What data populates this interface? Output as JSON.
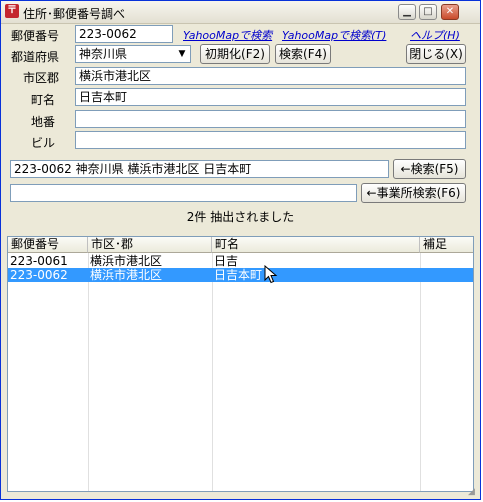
{
  "window": {
    "title": "住所･郵便番号調べ",
    "minimize": "▁",
    "maximize": "□",
    "close": "✕"
  },
  "form": {
    "postal_label": "郵便番号",
    "postal_value": "223-0062",
    "pref_label": "都道府県",
    "pref_value": "神奈川県",
    "city_label": "市区郡",
    "city_value": "横浜市港北区",
    "town_label": "町名",
    "town_value": "日吉本町",
    "banchi_label": "地番",
    "banchi_value": "",
    "building_label": "ビル",
    "building_value": ""
  },
  "links": {
    "yahoo_map": "YahooMapで検索",
    "yahoo_map_t": "YahooMapで検索(T)",
    "help": "ヘルプ(H)"
  },
  "buttons": {
    "init": "初期化(F2)",
    "search": "検索(F4)",
    "close": "閉じる(X)",
    "back_search": "←検索(F5)",
    "office_search": "←事業所検索(F6)"
  },
  "result": {
    "address_value": "223-0062 神奈川県 横浜市港北区 日吉本町",
    "office_value": "",
    "count_text": "2件 抽出されました"
  },
  "table": {
    "headers": [
      "郵便番号",
      "市区･郡",
      "町名",
      "補足"
    ],
    "rows": [
      [
        "223-0061",
        "横浜市港北区",
        "日吉",
        ""
      ],
      [
        "223-0062",
        "横浜市港北区",
        "日吉本町",
        ""
      ]
    ],
    "selected_row": 1
  },
  "colors": {
    "selection": "#3399ff",
    "link": "#0000cc",
    "face": "#ece9d8"
  }
}
